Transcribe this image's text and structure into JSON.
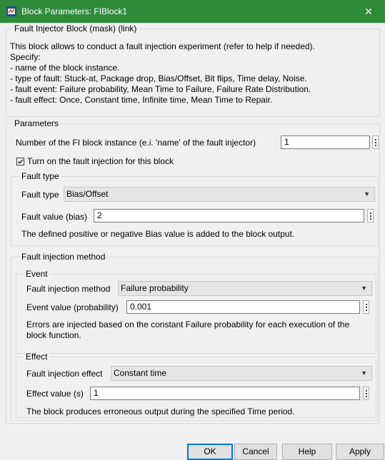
{
  "window": {
    "title": "Block Parameters: FIBlock1",
    "close_glyph": "✕"
  },
  "mask": {
    "title": "Fault Injector Block (mask) (link)",
    "description_lines": [
      "This block allows to conduct a fault injection experiment (refer to help if needed).",
      "Specify:",
      "- name of the block instance.",
      "- type of fault: Stuck-at, Package drop, Bias/Offset, Bit flips, Time delay, Noise.",
      "- fault event: Failure probability, Mean Time to Failure, Failure Rate Distribution.",
      "- fault effect: Once, Constant time, Infinite time, Mean Time to Repair."
    ]
  },
  "parameters": {
    "title": "Parameters",
    "instance_label": "Number of the FI block instance (e.i. 'name' of the fault injector)",
    "instance_value": "1",
    "enable_label": "Turn on the fault injection for this block",
    "enable_checked": true,
    "fault_type_group": {
      "title": "Fault type",
      "type_label": "Fault type",
      "type_value": "Bias/Offset",
      "value_label": "Fault value (bias)",
      "value": "2",
      "note": "The defined positive or negative Bias value is added to the block output."
    },
    "method_group": {
      "title": "Fault injection method",
      "event": {
        "title": "Event",
        "method_label": "Fault injection method",
        "method_value": "Failure probability",
        "value_label": "Event value (probability)",
        "value": "0.001",
        "note": "Errors are injected based on the constant Failure probability for each execution of the block function."
      },
      "effect": {
        "title": "Effect",
        "effect_label": "Fault injection effect",
        "effect_value": "Constant time",
        "value_label": "Effect value (s)",
        "value": "1",
        "note": "The block produces erroneous output during the specified Time period."
      }
    }
  },
  "buttons": {
    "ok": "OK",
    "cancel": "Cancel",
    "help": "Help",
    "apply": "Apply"
  },
  "colors": {
    "titlebar": "#2e8b3a",
    "dialog_bg": "#f0f0f0",
    "default_button_border": "#0078d7"
  },
  "icons": {
    "app": "simulink-block-icon",
    "close": "close-icon",
    "dropdown": "chevron-down-icon",
    "more": "more-options-icon",
    "checkbox": "checkbox-checked-icon"
  }
}
